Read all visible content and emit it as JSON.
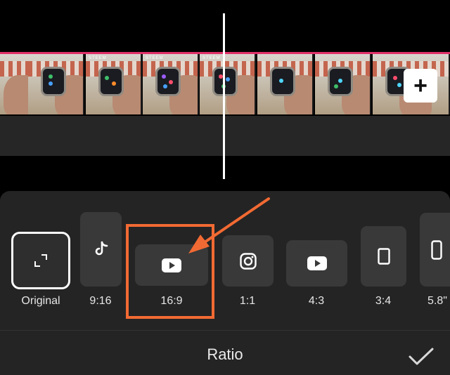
{
  "timeline": {
    "frames": [
      {
        "tag": ""
      },
      {
        "tag": ""
      },
      {
        "tag": "STEEM"
      },
      {
        "tag": "STEEM"
      },
      {
        "tag": "STEEM"
      },
      {
        "tag": ""
      },
      {
        "tag": ""
      },
      {
        "tag": ""
      }
    ],
    "add_label": "+"
  },
  "ratio_panel": {
    "title": "Ratio",
    "options": [
      {
        "label": "Original",
        "icon": "crop-corners-icon",
        "selected": true
      },
      {
        "label": "9:16",
        "icon": "tiktok-icon",
        "selected": false
      },
      {
        "label": "16:9",
        "icon": "youtube-icon",
        "selected": false
      },
      {
        "label": "1:1",
        "icon": "instagram-icon",
        "selected": false
      },
      {
        "label": "4:3",
        "icon": "youtube-icon",
        "selected": false
      },
      {
        "label": "3:4",
        "icon": "portrait-rect-icon",
        "selected": false
      },
      {
        "label": "5.8\"",
        "icon": "phone-rect-icon",
        "selected": false
      }
    ]
  },
  "annotation": {
    "color": "#f26a33"
  }
}
